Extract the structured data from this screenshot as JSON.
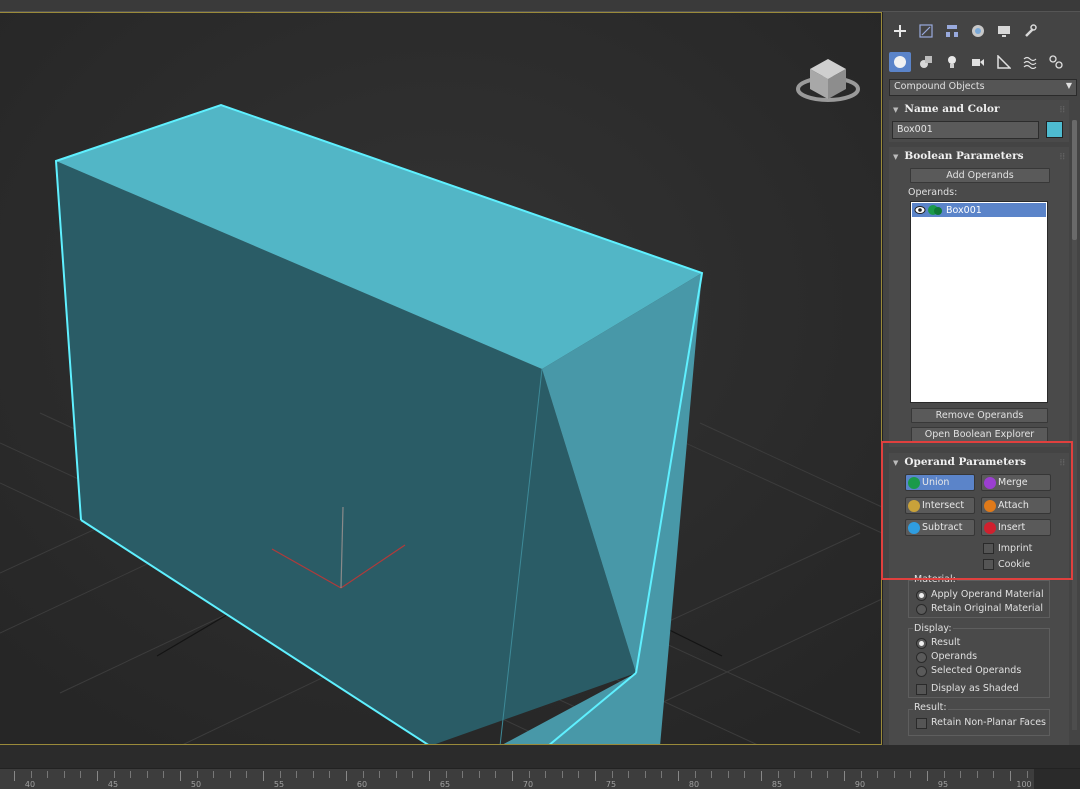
{
  "panel": {
    "dropdown_value": "Compound Objects",
    "name_and_color": {
      "title": "Name and Color",
      "object_name": "Box001",
      "color": "#4ebbd0"
    },
    "boolean_parameters": {
      "title": "Boolean Parameters",
      "add_operands": "Add Operands",
      "operands_label": "Operands:",
      "operands": [
        "Box001"
      ],
      "remove_operands": "Remove Operands",
      "open_explorer": "Open Boolean Explorer"
    },
    "operand_parameters": {
      "title": "Operand Parameters",
      "union": "Union",
      "merge": "Merge",
      "intersect": "Intersect",
      "attach": "Attach",
      "subtract": "Subtract",
      "insert": "Insert",
      "imprint": "Imprint",
      "cookie": "Cookie",
      "active_operation": "Union"
    },
    "material": {
      "label": "Material:",
      "apply": "Apply Operand Material",
      "retain": "Retain Original Material",
      "selected": "Apply Operand Material"
    },
    "display": {
      "label": "Display:",
      "result": "Result",
      "operands": "Operands",
      "selected_operands": "Selected Operands",
      "shaded": "Display as Shaded",
      "selected": "Result"
    },
    "result": {
      "label": "Result:",
      "retain_nonplanar": "Retain Non-Planar Faces"
    }
  },
  "timeline": {
    "labels": [
      "40",
      "45",
      "50",
      "55",
      "60",
      "65",
      "70",
      "75",
      "80",
      "85",
      "90",
      "95",
      "100"
    ]
  },
  "colors": {
    "box_top": "#52b6c6",
    "box_front": "#2a5c66",
    "box_side": "#4898a8",
    "selection_edge": "#5ff0ff",
    "accent": "#5b84c9",
    "highlight_frame": "#e0403e"
  }
}
